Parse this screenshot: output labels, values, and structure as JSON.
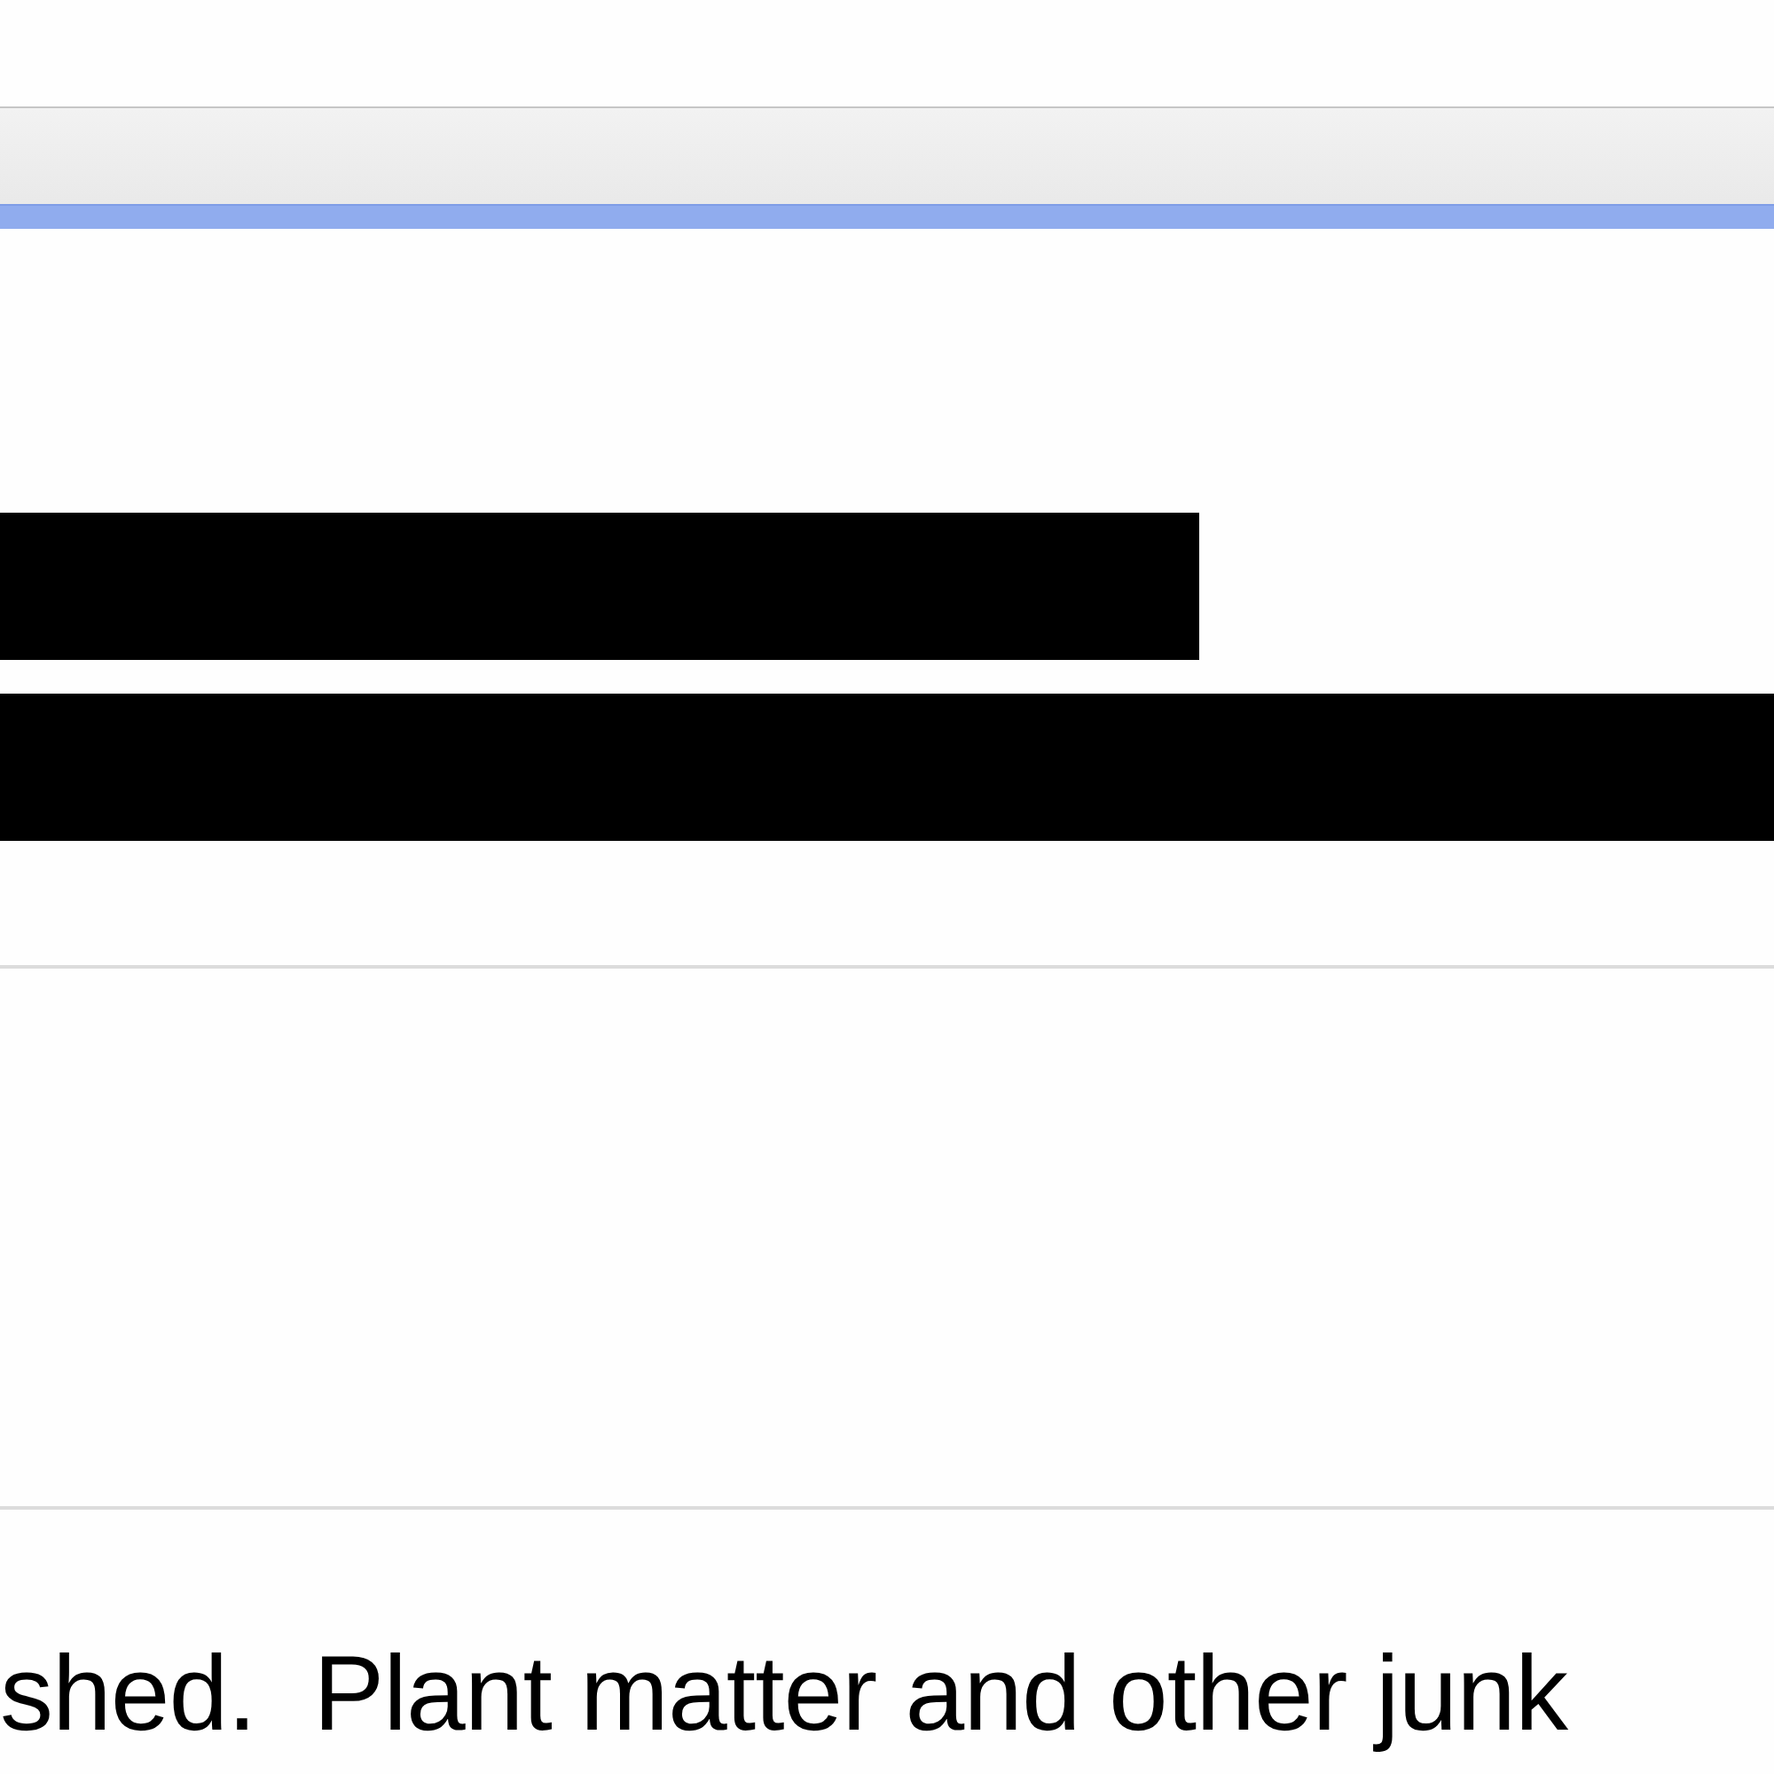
{
  "redacted_lines": [
    {
      "kind": "short"
    },
    {
      "kind": "full"
    }
  ],
  "body_text": "shed.  Plant matter and other junk"
}
